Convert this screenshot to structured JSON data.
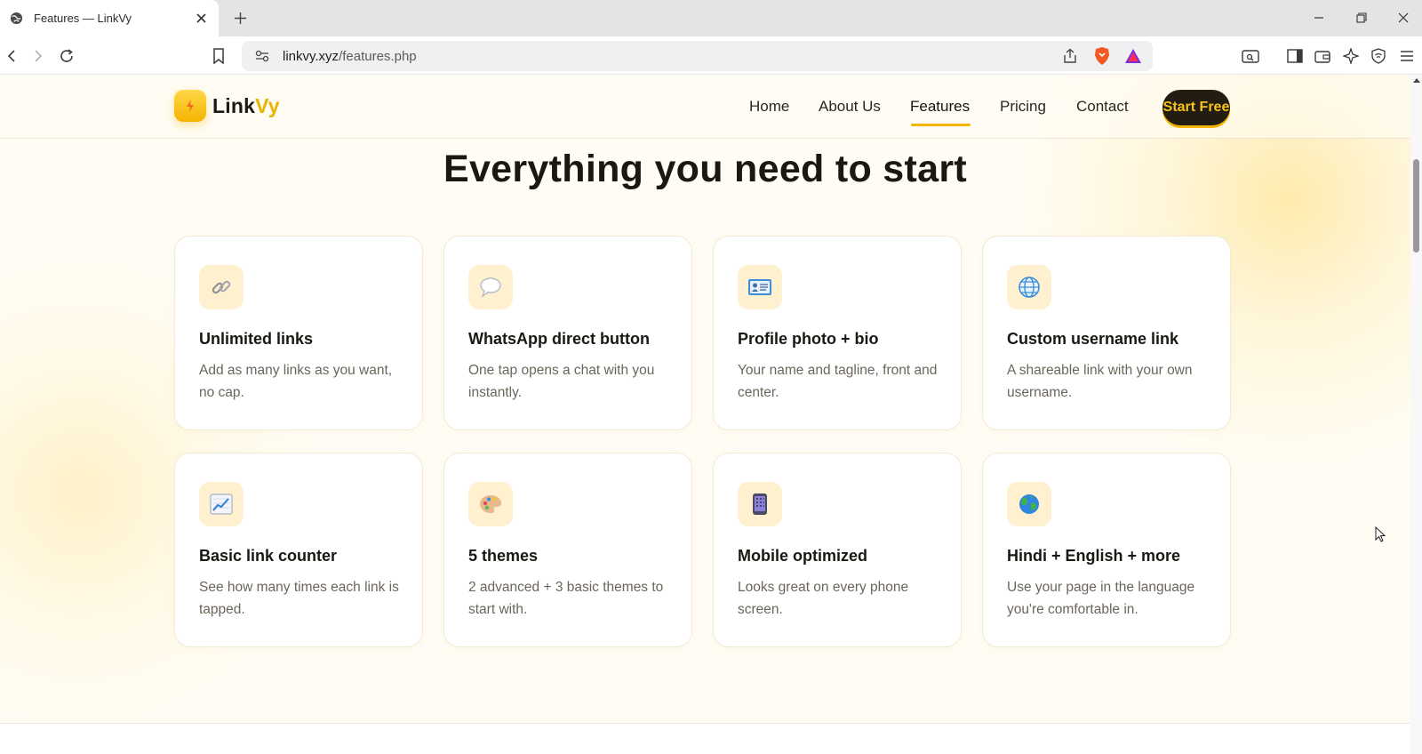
{
  "browser": {
    "tab": {
      "title": "Features — LinkVy"
    },
    "address": {
      "host": "linkvy.xyz",
      "path": "/features.php"
    }
  },
  "site": {
    "logo": {
      "main": "Link",
      "accent": "Vy"
    },
    "nav": [
      {
        "label": "Home"
      },
      {
        "label": "About Us"
      },
      {
        "label": "Features",
        "active": true
      },
      {
        "label": "Pricing"
      },
      {
        "label": "Contact"
      }
    ],
    "cta_label": "Start Free",
    "brand_color": "#f2b600"
  },
  "hero": {
    "title": "Everything you need to start"
  },
  "features": [
    {
      "icon": "link-icon",
      "title": "Unlimited links",
      "desc": "Add as many links as you want, no cap."
    },
    {
      "icon": "speech-bubble-icon",
      "title": "WhatsApp direct button",
      "desc": "One tap opens a chat with you instantly."
    },
    {
      "icon": "id-card-icon",
      "title": "Profile photo + bio",
      "desc": "Your name and tagline, front and center."
    },
    {
      "icon": "globe-icon",
      "title": "Custom username link",
      "desc": "A shareable link with your own username."
    },
    {
      "icon": "chart-increasing-icon",
      "title": "Basic link counter",
      "desc": "See how many times each link is tapped."
    },
    {
      "icon": "palette-icon",
      "title": "5 themes",
      "desc": "2 advanced + 3 basic themes to start with."
    },
    {
      "icon": "mobile-phone-icon",
      "title": "Mobile optimized",
      "desc": "Looks great on every phone screen."
    },
    {
      "icon": "earth-icon",
      "title": "Hindi + English + more",
      "desc": "Use your page in the language you're comfortable in."
    }
  ]
}
